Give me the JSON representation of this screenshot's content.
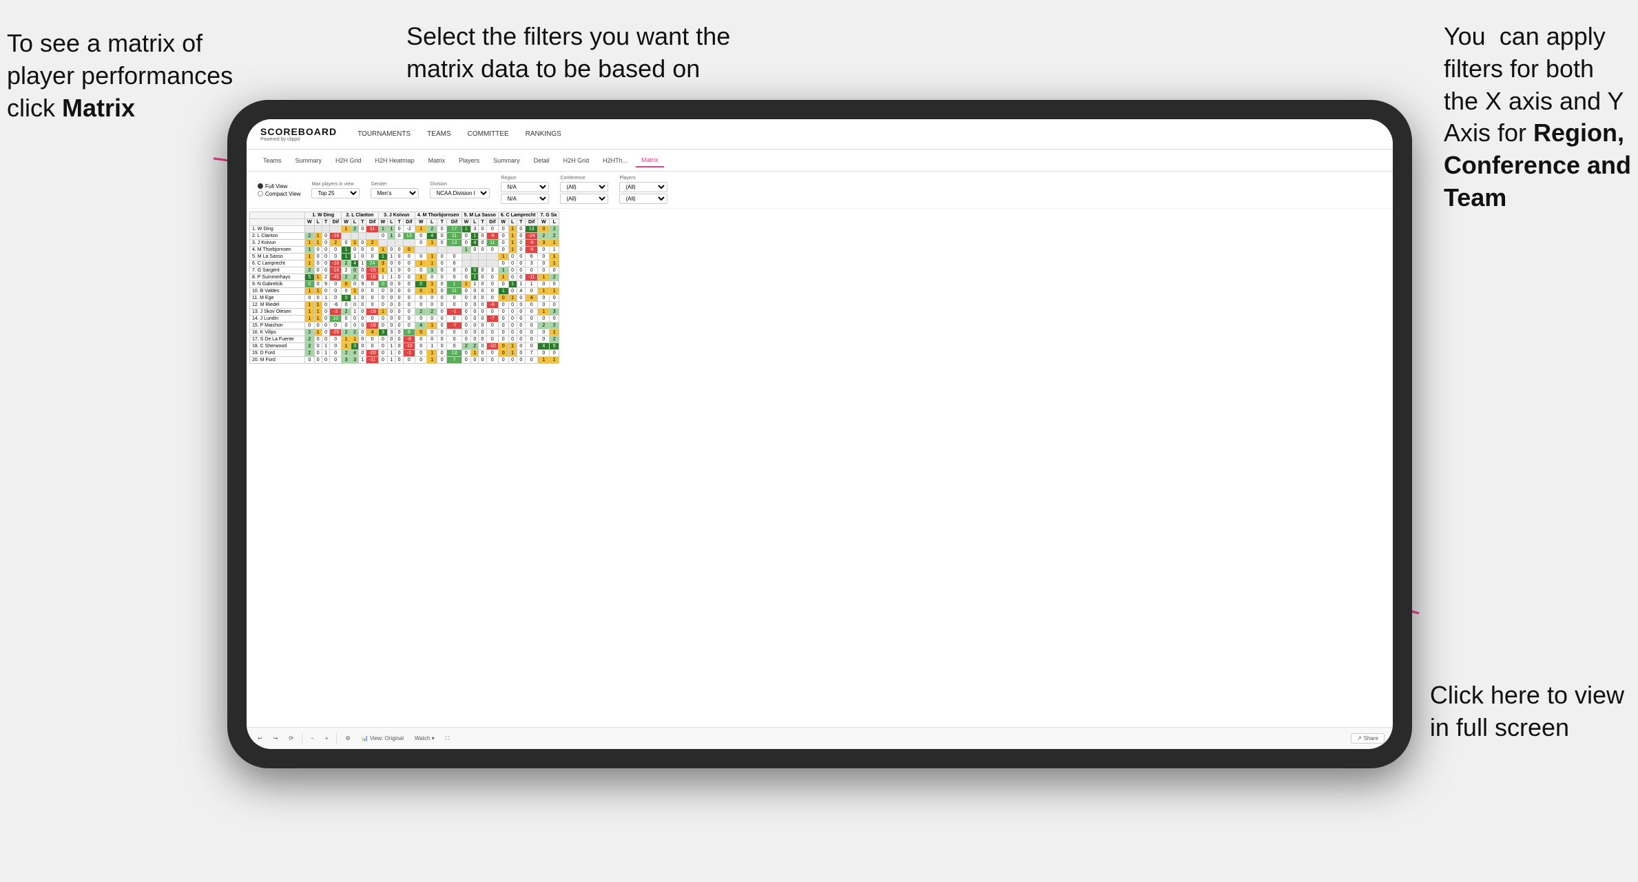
{
  "annotations": {
    "topleft": {
      "line1": "To see a matrix of",
      "line2": "player performances",
      "line3": "click ",
      "bold": "Matrix"
    },
    "topmid": {
      "text": "Select the filters you want the matrix data to be based on"
    },
    "topright": {
      "line1": "You  can apply",
      "line2": "filters for both",
      "line3": "the X axis and Y",
      "line4": "Axis for ",
      "bold1": "Region,",
      "line5": "",
      "bold2": "Conference and",
      "line6": "",
      "bold3": "Team"
    },
    "bottomright": {
      "line1": "Click here to view",
      "line2": "in full screen"
    }
  },
  "app": {
    "logo": "SCOREBOARD",
    "logo_sub": "Powered by clippd",
    "nav": [
      "TOURNAMENTS",
      "TEAMS",
      "COMMITTEE",
      "RANKINGS"
    ],
    "tabs_players": [
      "Teams",
      "Summary",
      "H2H Grid",
      "H2H Heatmap",
      "Matrix",
      "Players",
      "Summary",
      "Detail",
      "H2H Grid",
      "H2HTh...",
      "Matrix"
    ],
    "active_tab": "Matrix",
    "filters": {
      "view_options": [
        "Full View",
        "Compact View"
      ],
      "active_view": "Full View",
      "max_players_label": "Max players in view",
      "max_players_value": "Top 25",
      "gender_label": "Gender",
      "gender_value": "Men's",
      "division_label": "Division",
      "division_value": "NCAA Division I",
      "region_label": "Region",
      "region_value1": "N/A",
      "region_value2": "N/A",
      "conference_label": "Conference",
      "conference_value1": "(All)",
      "conference_value2": "(All)",
      "players_label": "Players",
      "players_value1": "(All)",
      "players_value2": "(All)"
    }
  },
  "matrix": {
    "col_headers": [
      "1. W Ding",
      "2. L Clanton",
      "3. J Koivun",
      "4. M Thorbjornsen",
      "5. M La Sasso",
      "6. C Lamprecht",
      "7. G Sa"
    ],
    "sub_headers": [
      "W",
      "L",
      "T",
      "Dif"
    ],
    "rows": [
      {
        "name": "1. W Ding",
        "data": ""
      },
      {
        "name": "2. L Clanton",
        "data": ""
      },
      {
        "name": "3. J Koivun",
        "data": ""
      },
      {
        "name": "4. M Thorbjornsen",
        "data": ""
      },
      {
        "name": "5. M La Sasso",
        "data": ""
      },
      {
        "name": "6. C Lamprecht",
        "data": ""
      },
      {
        "name": "7. G Sargent",
        "data": ""
      },
      {
        "name": "8. P Summerhays",
        "data": ""
      },
      {
        "name": "9. N Gabrelcik",
        "data": ""
      },
      {
        "name": "10. B Valdes",
        "data": ""
      },
      {
        "name": "11. M Ege",
        "data": ""
      },
      {
        "name": "12. M Riedel",
        "data": ""
      },
      {
        "name": "13. J Skov Olesen",
        "data": ""
      },
      {
        "name": "14. J Lundin",
        "data": ""
      },
      {
        "name": "15. P Maichon",
        "data": ""
      },
      {
        "name": "16. K Vilips",
        "data": ""
      },
      {
        "name": "17. S De La Fuente",
        "data": ""
      },
      {
        "name": "18. C Sherwood",
        "data": ""
      },
      {
        "name": "19. D Ford",
        "data": ""
      },
      {
        "name": "20. M Ford",
        "data": ""
      }
    ]
  },
  "toolbar": {
    "view_label": "View: Original",
    "watch_label": "Watch ▾",
    "share_label": "Share"
  }
}
